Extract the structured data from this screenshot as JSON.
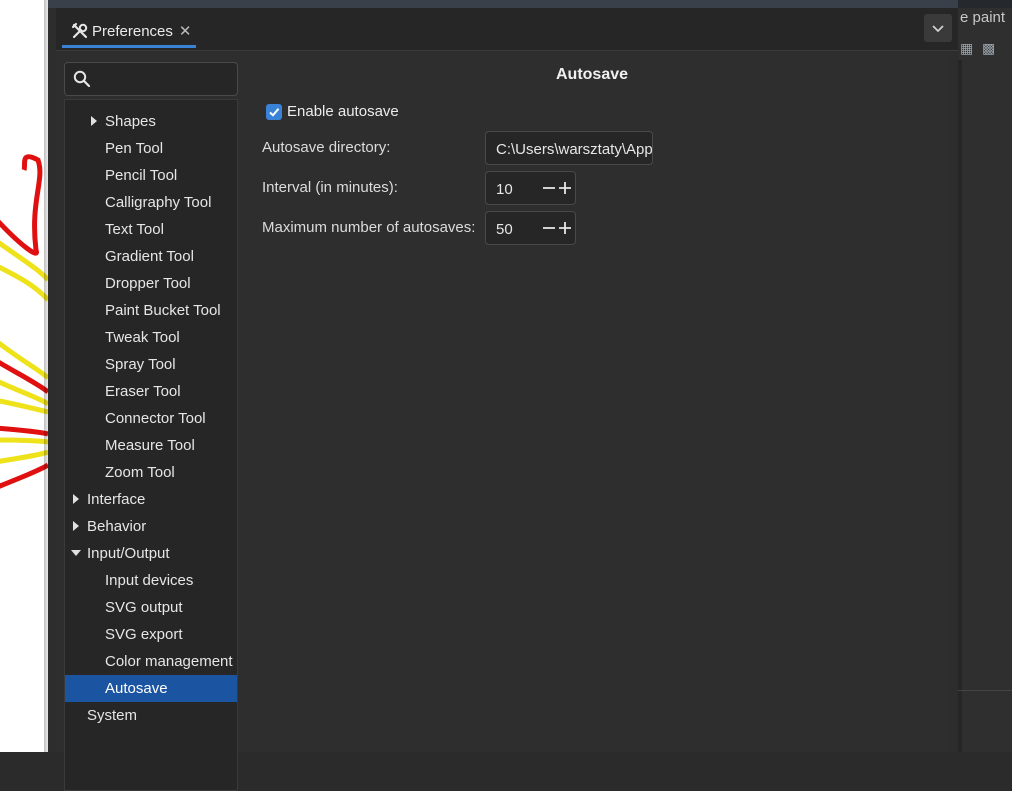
{
  "dialog": {
    "tab": {
      "title": "Preferences",
      "close": "✕",
      "icon": "tools-icon"
    },
    "menu_icon": "chevron-down-icon"
  },
  "background": {
    "right_tab_text": "e paint"
  },
  "search": {
    "placeholder": "",
    "icon": "search-icon"
  },
  "tree": {
    "items": [
      {
        "label": "Shapes",
        "level": 1,
        "expander": "collapsed"
      },
      {
        "label": "Pen Tool",
        "level": 1
      },
      {
        "label": "Pencil Tool",
        "level": 1
      },
      {
        "label": "Calligraphy Tool",
        "level": 1
      },
      {
        "label": "Text Tool",
        "level": 1
      },
      {
        "label": "Gradient Tool",
        "level": 1
      },
      {
        "label": "Dropper Tool",
        "level": 1
      },
      {
        "label": "Paint Bucket Tool",
        "level": 1
      },
      {
        "label": "Tweak Tool",
        "level": 1
      },
      {
        "label": "Spray Tool",
        "level": 1
      },
      {
        "label": "Eraser Tool",
        "level": 1
      },
      {
        "label": "Connector Tool",
        "level": 1
      },
      {
        "label": "Measure Tool",
        "level": 1
      },
      {
        "label": "Zoom Tool",
        "level": 1
      },
      {
        "label": "Interface",
        "level": 0,
        "expander": "collapsed"
      },
      {
        "label": "Behavior",
        "level": 0,
        "expander": "collapsed"
      },
      {
        "label": "Input/Output",
        "level": 0,
        "expander": "expanded"
      },
      {
        "label": "Input devices",
        "level": 1
      },
      {
        "label": "SVG output",
        "level": 1
      },
      {
        "label": "SVG export",
        "level": 1
      },
      {
        "label": "Color management",
        "level": 1
      },
      {
        "label": "Autosave",
        "level": 1,
        "selected": true
      },
      {
        "label": "System",
        "level": 0
      }
    ]
  },
  "page": {
    "title": "Autosave",
    "enable_autosave": {
      "label": "Enable autosave",
      "checked": true
    },
    "directory": {
      "label": "Autosave directory:",
      "value": "C:\\Users\\warsztaty\\AppData"
    },
    "interval": {
      "label": "Interval (in minutes):",
      "value": "10"
    },
    "max_autosaves": {
      "label": "Maximum number of autosaves:",
      "value": "50"
    }
  },
  "colors": {
    "accent": "#3a82d6",
    "selection": "#1b55a2",
    "panel": "#2e2e2e"
  }
}
